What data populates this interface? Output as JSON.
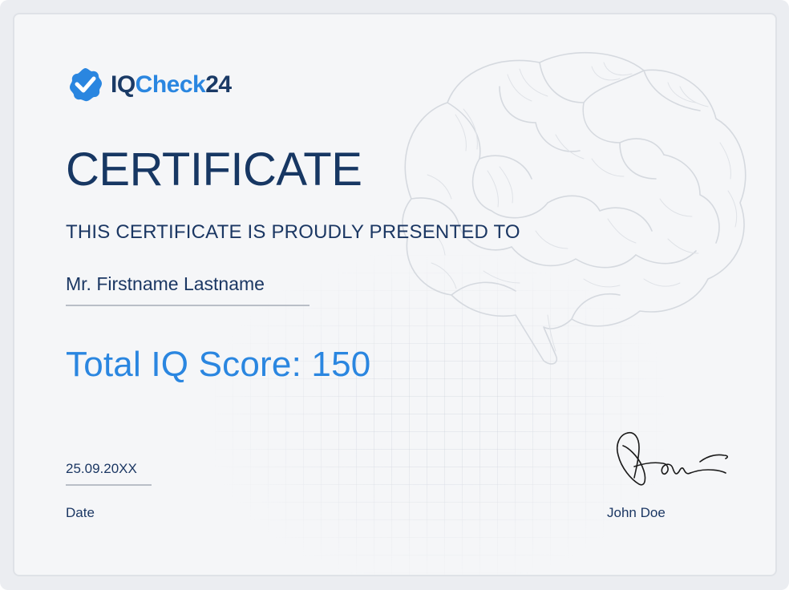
{
  "brand": {
    "name_part1": "IQ",
    "name_part2": "Check",
    "name_part3": "24",
    "colors": {
      "dark": "#1a3a66",
      "accent": "#2a86e0"
    },
    "icon": "checkmark-badge-icon"
  },
  "certificate": {
    "title": "CERTIFICATE",
    "subtitle": "THIS CERTIFICATE IS PROUDLY PRESENTED TO",
    "recipient": "Mr. Firstname Lastname",
    "score_text": "Total IQ Score: 150",
    "date_value": "25.09.20XX",
    "date_label": "Date",
    "signer_name": "John Doe"
  },
  "decor": {
    "background_image": "brain-illustration",
    "signature": "handwritten-signature"
  }
}
